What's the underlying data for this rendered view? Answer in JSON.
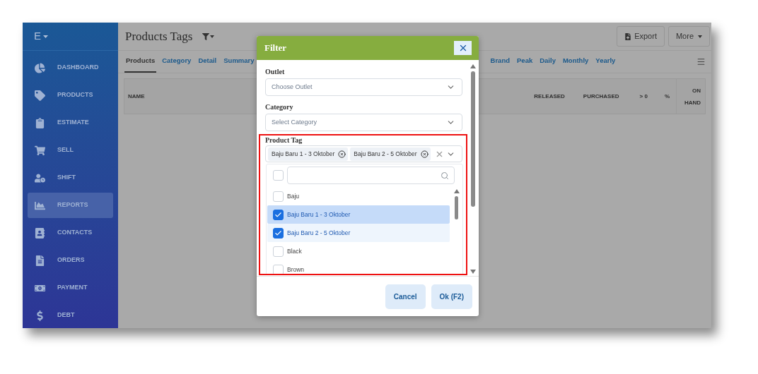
{
  "app": {
    "brand": "E",
    "title": "Products Tags",
    "export_button": "Export",
    "more_button": "More"
  },
  "sidebar": {
    "items": [
      {
        "label": "DASHBOARD",
        "selected": false
      },
      {
        "label": "PRODUCTS",
        "selected": false
      },
      {
        "label": "ESTIMATE",
        "selected": false
      },
      {
        "label": "SELL",
        "selected": false
      },
      {
        "label": "SHIFT",
        "selected": false
      },
      {
        "label": "REPORTS",
        "selected": true
      },
      {
        "label": "CONTACTS",
        "selected": false
      },
      {
        "label": "ORDERS",
        "selected": false
      },
      {
        "label": "PAYMENT",
        "selected": false
      },
      {
        "label": "DEBT",
        "selected": false
      }
    ]
  },
  "tabs": [
    {
      "label": "Products",
      "selected": true
    },
    {
      "label": "Category",
      "selected": false
    },
    {
      "label": "Detail",
      "selected": false
    },
    {
      "label": "Summary",
      "selected": false
    },
    {
      "label": "Brand",
      "selected": false
    },
    {
      "label": "Peak",
      "selected": false
    },
    {
      "label": "Daily",
      "selected": false
    },
    {
      "label": "Monthly",
      "selected": false
    },
    {
      "label": "Yearly",
      "selected": false
    }
  ],
  "table": {
    "columns": [
      "NAME",
      "RELEASED",
      "PURCHASED",
      "> 0",
      "%",
      "ON HAND"
    ]
  },
  "filter_dialog": {
    "title": "Filter",
    "fields": [
      {
        "label": "Outlet",
        "placeholder": "Choose Outlet"
      },
      {
        "label": "Category",
        "placeholder": "Select Category"
      }
    ],
    "product_tag": {
      "label": "Product Tag",
      "tags": [
        "Baju Baru 1 - 3 Oktober",
        "Baju Baru 2 - 5 Oktober"
      ],
      "select_all_checked": false,
      "options": [
        {
          "label": "Baju",
          "checked": false,
          "focused": false
        },
        {
          "label": "Baju Baru 1 - 3 Oktober",
          "checked": true,
          "focused": true
        },
        {
          "label": "Baju Baru 2 - 5 Oktober",
          "checked": true,
          "focused": false
        },
        {
          "label": "Black",
          "checked": false,
          "focused": false
        },
        {
          "label": "Brown",
          "checked": false,
          "focused": false
        }
      ]
    },
    "buttons": [
      "Cancel",
      "Ok (F2)"
    ]
  }
}
